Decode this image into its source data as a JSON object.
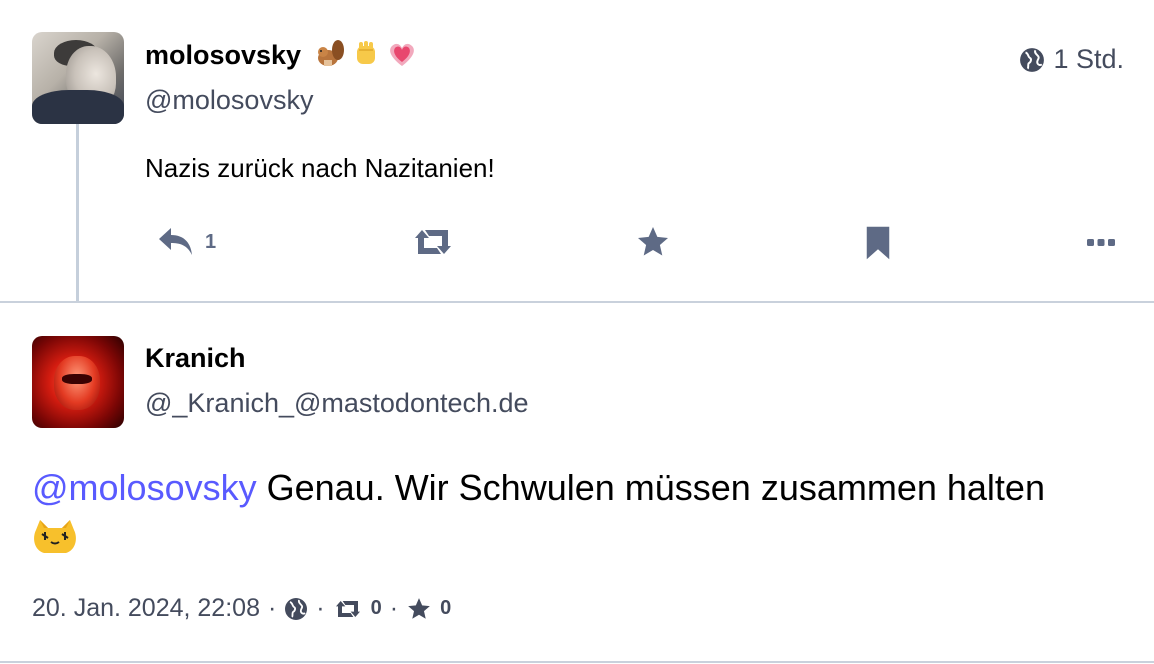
{
  "post1": {
    "author_name": "molosovsky",
    "author_emojis": [
      "chipmunk-emoji",
      "raised-fist-emoji",
      "growing-heart-emoji"
    ],
    "handle": "@molosovsky",
    "time": "1 Std.",
    "text": "Nazis zurück nach Nazitanien!",
    "reply_count": "1"
  },
  "post2": {
    "author_name": "Kranich",
    "handle": "@_Kranich_@mastodontech.de",
    "mention": "@molosovsky",
    "text": " Genau. Wir Schwulen müssen zusammen halten",
    "custom_emoji": "blobcat-emoji",
    "date": "20. Jan. 2024, 22:08",
    "separator": "·",
    "boost_count": "0",
    "fav_count": "0"
  },
  "colors": {
    "accent": "#595aff",
    "muted": "#444b5d",
    "icon": "#5e6a85",
    "divider": "#c9d1dc"
  }
}
